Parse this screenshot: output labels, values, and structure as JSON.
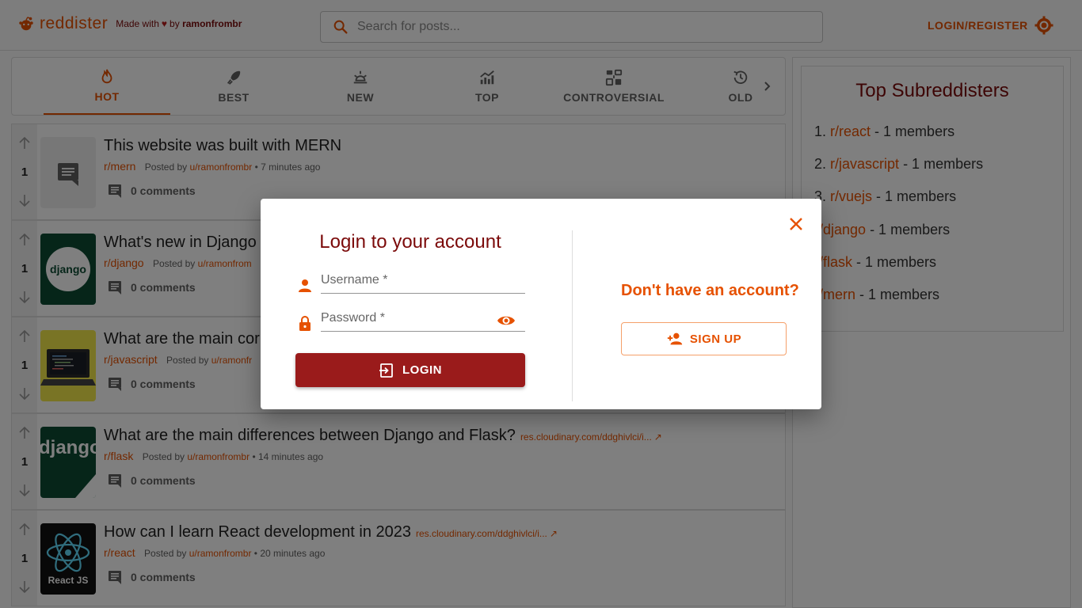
{
  "header": {
    "brand": "reddister",
    "made_with": "Made with",
    "by": "by",
    "author": "ramonfrombr",
    "search_placeholder": "Search for posts...",
    "login_register": "LOGIN/REGISTER"
  },
  "tabs": [
    {
      "label": "HOT",
      "icon": "fire-icon",
      "active": true
    },
    {
      "label": "BEST",
      "icon": "rocket-icon"
    },
    {
      "label": "NEW",
      "icon": "sun-icon"
    },
    {
      "label": "TOP",
      "icon": "trending-icon"
    },
    {
      "label": "CONTROVERSIAL",
      "icon": "controversy-icon"
    },
    {
      "label": "OLD",
      "icon": "history-icon"
    }
  ],
  "posts": [
    {
      "votes": "1",
      "title": "This website was built with MERN",
      "link": "",
      "subreddit": "r/mern",
      "posted_by": "Posted by",
      "user": "u/ramonfrombr",
      "time": "• 7 minutes ago",
      "comments": "0 comments",
      "thumb": "text-post-icon"
    },
    {
      "votes": "1",
      "title": "What's new in Django",
      "link": "",
      "subreddit": "r/django",
      "posted_by": "Posted by",
      "user": "u/ramonfrom",
      "time": "",
      "comments": "0 comments",
      "thumb": "django-logo"
    },
    {
      "votes": "1",
      "title": "What are the main cor",
      "link": "",
      "subreddit": "r/javascript",
      "posted_by": "Posted by",
      "user": "u/ramonfr",
      "time": "",
      "comments": "0 comments",
      "thumb": "laptop-code-image"
    },
    {
      "votes": "1",
      "title": "What are the main differences between Django and Flask?",
      "link": "res.cloudinary.com/ddghivlci/i...",
      "subreddit": "r/flask",
      "posted_by": "Posted by",
      "user": "u/ramonfrombr",
      "time": "• 14 minutes ago",
      "comments": "0 comments",
      "thumb": "django-wordmark"
    },
    {
      "votes": "1",
      "title": "How can I learn React development in 2023",
      "link": "res.cloudinary.com/ddghivlci/i...",
      "subreddit": "r/react",
      "posted_by": "Posted by",
      "user": "u/ramonfrombr",
      "time": "• 20 minutes ago",
      "comments": "0 comments",
      "thumb": "react-logo",
      "thumb_label": "React JS"
    }
  ],
  "django_logo_text": "django",
  "top_subs": {
    "title": "Top Subreddisters",
    "items": [
      {
        "num": "1.",
        "name": "r/react",
        "members": " - 1 members"
      },
      {
        "num": "2.",
        "name": "r/javascript",
        "members": " - 1 members"
      },
      {
        "num": "3.",
        "name": "r/vuejs",
        "members": " - 1 members"
      },
      {
        "num": "",
        "name": "r/django",
        "members": " - 1 members"
      },
      {
        "num": "",
        "name": "r/flask",
        "members": " - 1 members"
      },
      {
        "num": "",
        "name": "r/mern",
        "members": " - 1 members"
      }
    ]
  },
  "modal": {
    "heading": "Login to your account",
    "username_placeholder": "Username *",
    "password_placeholder": "Password *",
    "login_label": "LOGIN",
    "no_account": "Don't have an account?",
    "signup_label": "SIGN UP"
  },
  "colors": {
    "accent": "#e65100",
    "brand_dark": "#9a1b1b"
  }
}
